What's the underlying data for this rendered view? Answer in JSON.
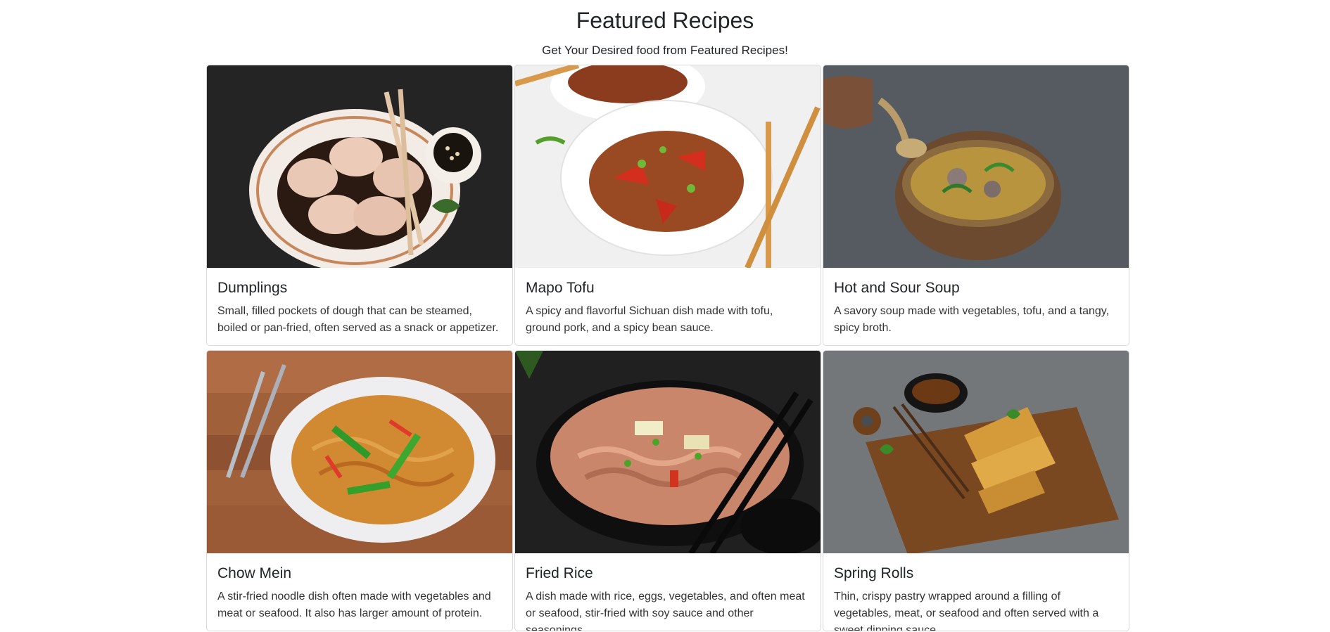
{
  "header": {
    "title": "Featured Recipes",
    "subtitle": "Get Your Desired food from Featured Recipes!"
  },
  "recipes": [
    {
      "title": "Dumplings",
      "description": "Small, filled pockets of dough that can be steamed, boiled or pan-fried, often served as a snack or appetizer.",
      "image": "dumplings-photo"
    },
    {
      "title": "Mapo Tofu",
      "description": "A spicy and flavorful Sichuan dish made with tofu, ground pork, and a spicy bean sauce.",
      "image": "mapo-tofu-photo"
    },
    {
      "title": "Hot and Sour Soup",
      "description": "A savory soup made with vegetables, tofu, and a tangy, spicy broth.",
      "image": "hot-and-sour-soup-photo"
    },
    {
      "title": "Chow Mein",
      "description": "A stir-fried noodle dish often made with vegetables and meat or seafood. It also has larger amount of protein.",
      "image": "chow-mein-photo"
    },
    {
      "title": "Fried Rice",
      "description": "A dish made with rice, eggs, vegetables, and often meat or seafood, stir-fried with soy sauce and other seasonings.",
      "image": "fried-rice-photo"
    },
    {
      "title": "Spring Rolls",
      "description": "Thin, crispy pastry wrapped around a filling of vegetables, meat, or seafood and often served with a sweet dipping sauce.",
      "image": "spring-rolls-photo"
    }
  ]
}
